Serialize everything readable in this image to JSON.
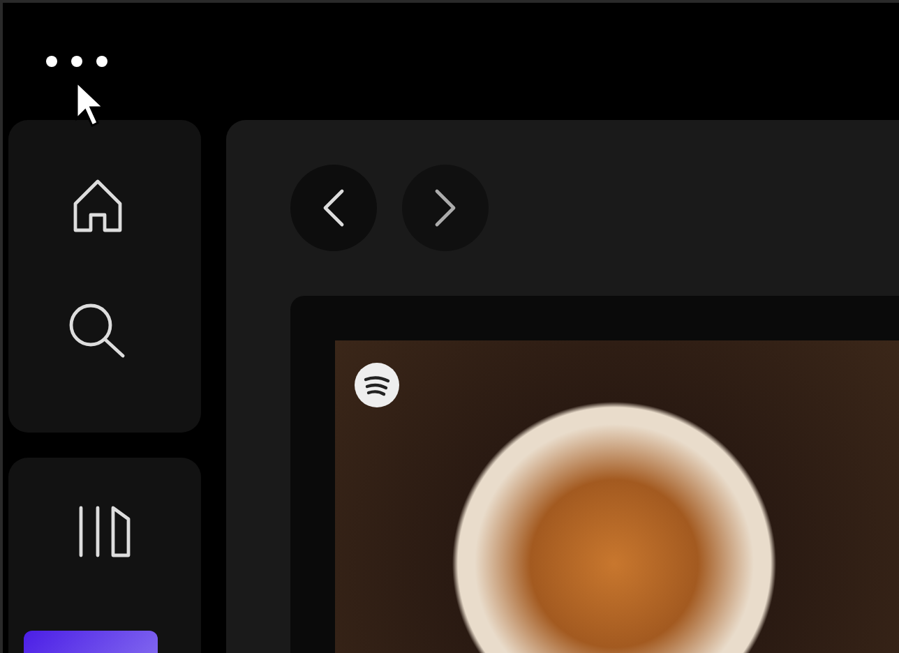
{
  "titlebar": {
    "menu": {
      "kind": "dots"
    }
  },
  "sidebar": {
    "nav": [
      {
        "kind": "home"
      },
      {
        "kind": "search"
      }
    ],
    "library": {
      "kind": "library"
    }
  },
  "main": {
    "nav_buttons": [
      {
        "kind": "back"
      },
      {
        "kind": "forward"
      }
    ]
  }
}
